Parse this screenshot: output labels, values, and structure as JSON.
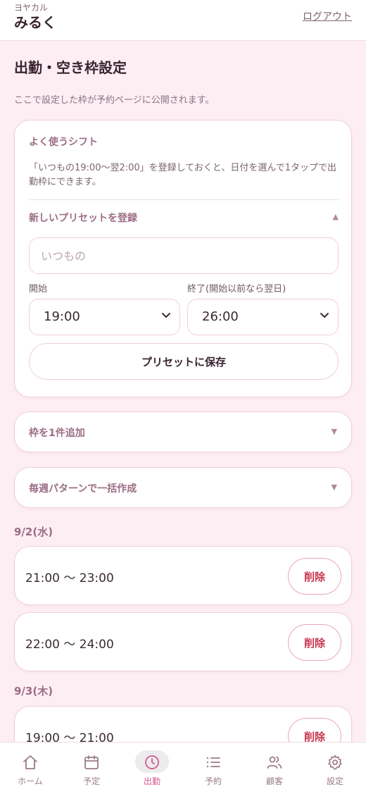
{
  "header": {
    "brand_small": "ヨヤカル",
    "brand_main": "みるく",
    "logout_label": "ログアウト"
  },
  "page": {
    "title": "出勤・空き枠設定",
    "description": "ここで設定した枠が予約ページに公開されます。"
  },
  "preset": {
    "title": "よく使うシフト",
    "description": "「いつもの19:00〜翌2:00」を登録しておくと、日付を選んで1タップで出勤枠にできます。",
    "new_label": "新しいプリセットを登録",
    "expanded_caret": "▲",
    "name_placeholder": "いつもの",
    "start_label": "開始",
    "end_label": "終了(開始以前なら翌日)",
    "start_value": "19:00",
    "end_value": "26:00",
    "save_label": "プリセットに保存"
  },
  "sections": {
    "add_one_label": "枠を1件追加",
    "weekly_label": "毎週パターンで一括作成",
    "collapsed_caret": "▼"
  },
  "schedule": [
    {
      "date": "9/2(水)",
      "slots": [
        "21:00 〜 23:00",
        "22:00 〜 24:00"
      ]
    },
    {
      "date": "9/3(木)",
      "slots": [
        "19:00 〜 21:00"
      ]
    }
  ],
  "delete_label": "削除",
  "nav": {
    "items": [
      {
        "label": "ホーム",
        "icon": "home-icon"
      },
      {
        "label": "予定",
        "icon": "calendar-icon"
      },
      {
        "label": "出勤",
        "icon": "clock-icon",
        "active": true
      },
      {
        "label": "予約",
        "icon": "list-icon"
      },
      {
        "label": "顧客",
        "icon": "users-icon"
      },
      {
        "label": "設定",
        "icon": "gear-icon"
      }
    ]
  },
  "colors": {
    "background": "#fdeef4",
    "accent": "#d45a92",
    "section_heading": "#9b6d84",
    "delete": "#c8354e"
  }
}
